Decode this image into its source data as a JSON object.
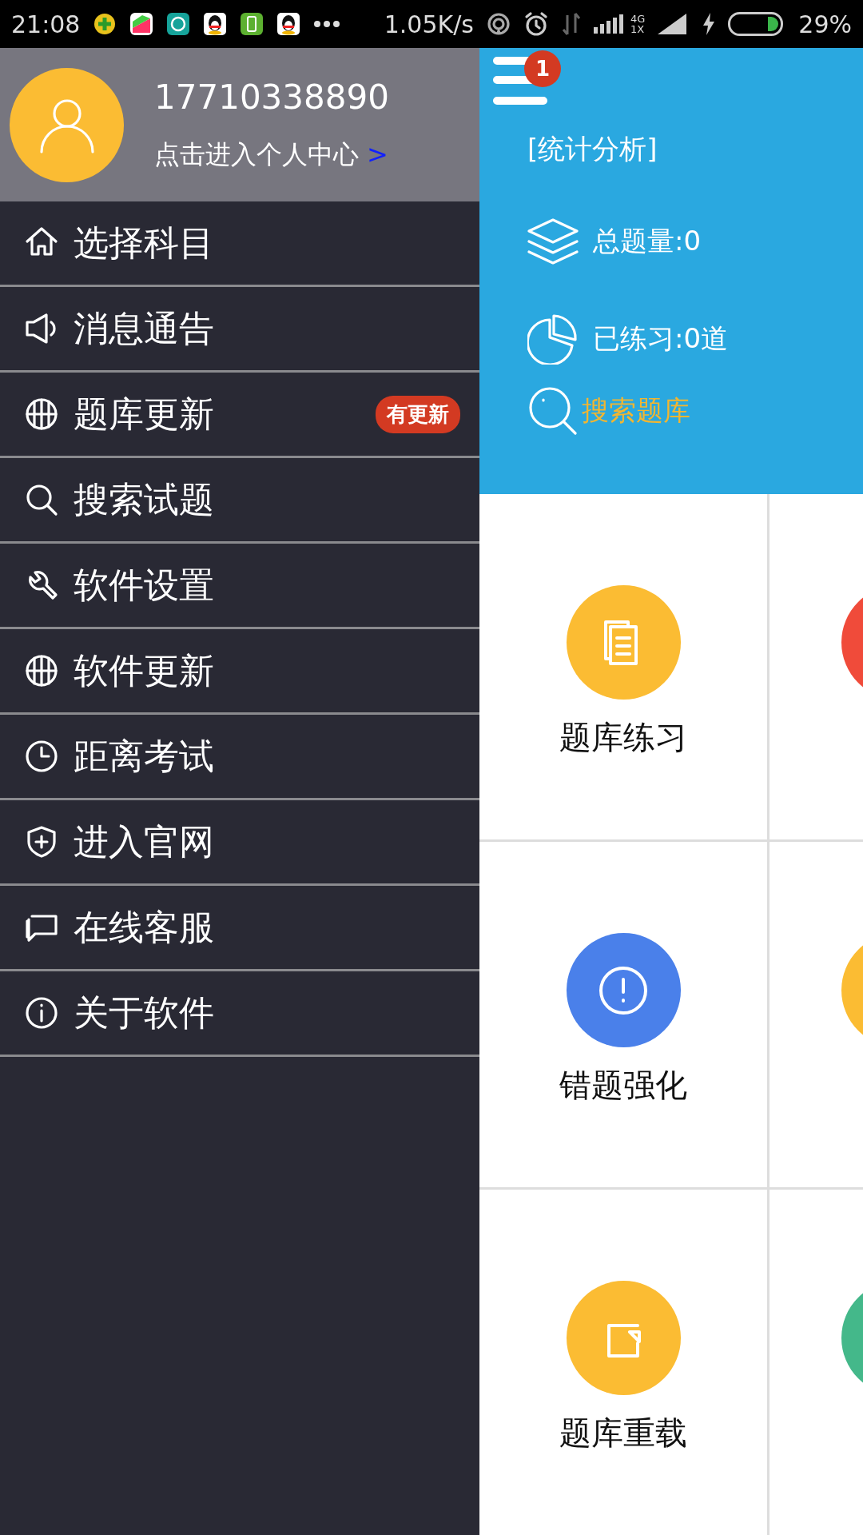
{
  "status_bar": {
    "time": "21:08",
    "net_speed": "1.05K/s",
    "network_type": [
      "4G",
      "1X"
    ],
    "battery": "29%"
  },
  "drawer": {
    "phone": "17710338890",
    "profile_link": "点击进入个人中心",
    "profile_arrow": ">",
    "items": [
      {
        "label": "选择科目"
      },
      {
        "label": "消息通告"
      },
      {
        "label": "题库更新",
        "badge": "有更新"
      },
      {
        "label": "搜索试题"
      },
      {
        "label": "软件设置"
      },
      {
        "label": "软件更新"
      },
      {
        "label": "距离考试"
      },
      {
        "label": "进入官网"
      },
      {
        "label": "在线客服"
      },
      {
        "label": "关于软件"
      }
    ]
  },
  "panel": {
    "menu_badge": "1",
    "title": "[统计分析]",
    "stats": [
      "总题量:0",
      "已练习:0道"
    ],
    "search_link": "搜索题库",
    "tiles": [
      {
        "label": "题库练习",
        "color": "#fbbc33"
      },
      {
        "label": "错题强化",
        "color": "#4a80ea"
      },
      {
        "label": "题库重载",
        "color": "#fbbc33"
      }
    ],
    "cut_tiles": [
      {
        "color": "#f04b3a"
      },
      {
        "color": "#fbbc33"
      },
      {
        "color": "#44b88a"
      }
    ]
  }
}
